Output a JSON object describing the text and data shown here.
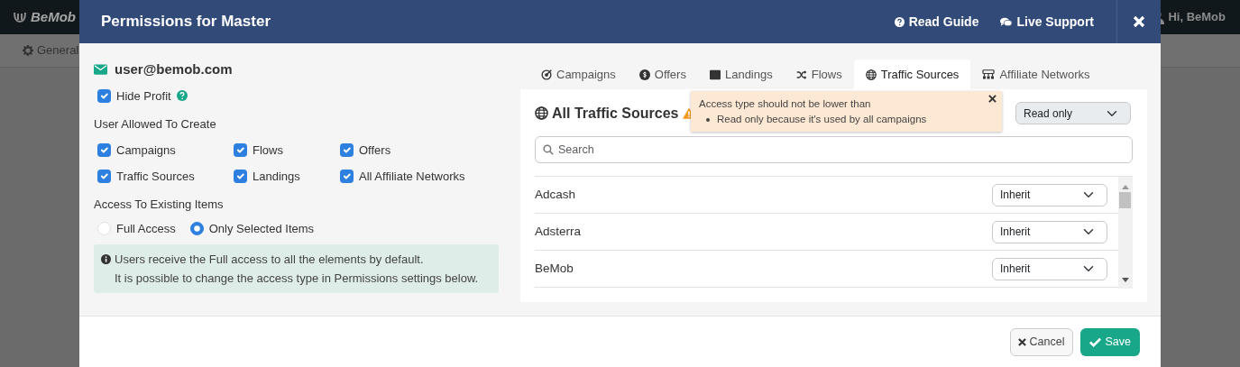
{
  "app": {
    "logo": "BeMob",
    "user": "Hi, BeMob",
    "nav_item": "General"
  },
  "modal": {
    "title": "Permissions for Master",
    "header_links": [
      "Read Guide",
      "Live Support"
    ],
    "email": "user@bemob.com",
    "hide_profit": {
      "label": "Hide Profit",
      "checked": true
    },
    "create_heading": "User Allowed To Create",
    "create_items": [
      {
        "label": "Campaigns",
        "checked": true
      },
      {
        "label": "Flows",
        "checked": true
      },
      {
        "label": "Offers",
        "checked": true
      },
      {
        "label": "Traffic Sources",
        "checked": true
      },
      {
        "label": "Landings",
        "checked": true
      },
      {
        "label": "All Affiliate Networks",
        "checked": true
      }
    ],
    "access_heading": "Access To Existing Items",
    "access_options": [
      {
        "label": "Full Access",
        "selected": false
      },
      {
        "label": "Only Selected Items",
        "selected": true
      }
    ],
    "info_lines": [
      "Users receive the Full access to all the elements by default.",
      "It is possible to change the access type in Permissions settings below."
    ],
    "tabs": [
      {
        "label": "Campaigns",
        "selected": false
      },
      {
        "label": "Offers",
        "selected": false
      },
      {
        "label": "Landings",
        "selected": false
      },
      {
        "label": "Flows",
        "selected": false
      },
      {
        "label": "Traffic Sources",
        "selected": true
      },
      {
        "label": "Affiliate Networks",
        "selected": false
      }
    ],
    "panel": {
      "title": "All Traffic Sources",
      "all_access": "Read only",
      "search": {
        "placeholder": "Search"
      },
      "rows": [
        {
          "name": "Adcash",
          "access": "Inherit"
        },
        {
          "name": "Adsterra",
          "access": "Inherit"
        },
        {
          "name": "BeMob",
          "access": "Inherit"
        }
      ]
    },
    "tooltip": {
      "title": "Access type should not be lower than",
      "items": [
        "Read only because it's used by all campaigns"
      ]
    },
    "buttons": [
      {
        "kind": "cancel",
        "label": "Cancel"
      },
      {
        "kind": "save",
        "label": "Save"
      }
    ]
  }
}
